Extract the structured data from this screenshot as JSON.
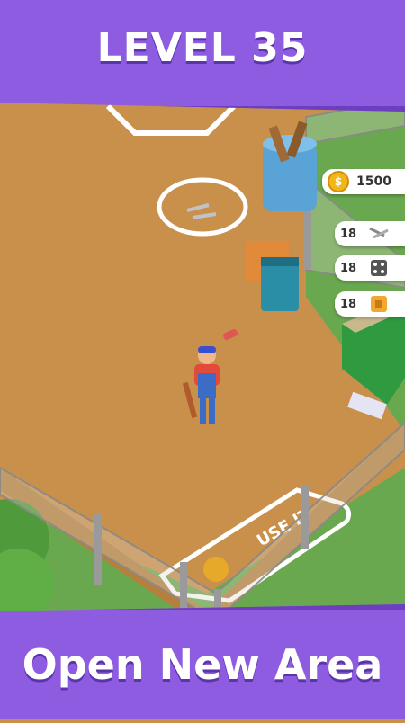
{
  "level": {
    "title": "LEVEL 35"
  },
  "footer": {
    "caption": "Open New Area"
  },
  "hud": {
    "coins": {
      "value": "1500",
      "icon": "coin-icon"
    },
    "items": [
      {
        "count": "18",
        "icon": "nails-icon"
      },
      {
        "count": "18",
        "icon": "dice-icon"
      },
      {
        "count": "18",
        "icon": "circuit-chip-icon"
      }
    ]
  },
  "ground_marking": {
    "text": "USE IT"
  },
  "colors": {
    "banner": "#8e5ce0",
    "ground": "#c8904a",
    "grass": "#6aa84f",
    "fence": "#8a8a8a"
  }
}
